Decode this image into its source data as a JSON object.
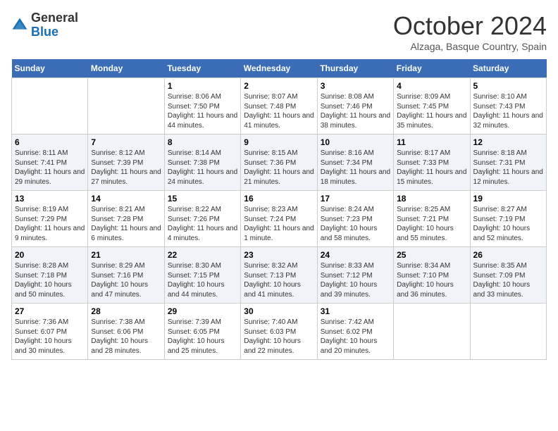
{
  "header": {
    "logo_general": "General",
    "logo_blue": "Blue",
    "month_title": "October 2024",
    "location": "Alzaga, Basque Country, Spain"
  },
  "days_of_week": [
    "Sunday",
    "Monday",
    "Tuesday",
    "Wednesday",
    "Thursday",
    "Friday",
    "Saturday"
  ],
  "weeks": [
    [
      {
        "day": "",
        "info": ""
      },
      {
        "day": "",
        "info": ""
      },
      {
        "day": "1",
        "info": "Sunrise: 8:06 AM\nSunset: 7:50 PM\nDaylight: 11 hours and 44 minutes."
      },
      {
        "day": "2",
        "info": "Sunrise: 8:07 AM\nSunset: 7:48 PM\nDaylight: 11 hours and 41 minutes."
      },
      {
        "day": "3",
        "info": "Sunrise: 8:08 AM\nSunset: 7:46 PM\nDaylight: 11 hours and 38 minutes."
      },
      {
        "day": "4",
        "info": "Sunrise: 8:09 AM\nSunset: 7:45 PM\nDaylight: 11 hours and 35 minutes."
      },
      {
        "day": "5",
        "info": "Sunrise: 8:10 AM\nSunset: 7:43 PM\nDaylight: 11 hours and 32 minutes."
      }
    ],
    [
      {
        "day": "6",
        "info": "Sunrise: 8:11 AM\nSunset: 7:41 PM\nDaylight: 11 hours and 29 minutes."
      },
      {
        "day": "7",
        "info": "Sunrise: 8:12 AM\nSunset: 7:39 PM\nDaylight: 11 hours and 27 minutes."
      },
      {
        "day": "8",
        "info": "Sunrise: 8:14 AM\nSunset: 7:38 PM\nDaylight: 11 hours and 24 minutes."
      },
      {
        "day": "9",
        "info": "Sunrise: 8:15 AM\nSunset: 7:36 PM\nDaylight: 11 hours and 21 minutes."
      },
      {
        "day": "10",
        "info": "Sunrise: 8:16 AM\nSunset: 7:34 PM\nDaylight: 11 hours and 18 minutes."
      },
      {
        "day": "11",
        "info": "Sunrise: 8:17 AM\nSunset: 7:33 PM\nDaylight: 11 hours and 15 minutes."
      },
      {
        "day": "12",
        "info": "Sunrise: 8:18 AM\nSunset: 7:31 PM\nDaylight: 11 hours and 12 minutes."
      }
    ],
    [
      {
        "day": "13",
        "info": "Sunrise: 8:19 AM\nSunset: 7:29 PM\nDaylight: 11 hours and 9 minutes."
      },
      {
        "day": "14",
        "info": "Sunrise: 8:21 AM\nSunset: 7:28 PM\nDaylight: 11 hours and 6 minutes."
      },
      {
        "day": "15",
        "info": "Sunrise: 8:22 AM\nSunset: 7:26 PM\nDaylight: 11 hours and 4 minutes."
      },
      {
        "day": "16",
        "info": "Sunrise: 8:23 AM\nSunset: 7:24 PM\nDaylight: 11 hours and 1 minute."
      },
      {
        "day": "17",
        "info": "Sunrise: 8:24 AM\nSunset: 7:23 PM\nDaylight: 10 hours and 58 minutes."
      },
      {
        "day": "18",
        "info": "Sunrise: 8:25 AM\nSunset: 7:21 PM\nDaylight: 10 hours and 55 minutes."
      },
      {
        "day": "19",
        "info": "Sunrise: 8:27 AM\nSunset: 7:19 PM\nDaylight: 10 hours and 52 minutes."
      }
    ],
    [
      {
        "day": "20",
        "info": "Sunrise: 8:28 AM\nSunset: 7:18 PM\nDaylight: 10 hours and 50 minutes."
      },
      {
        "day": "21",
        "info": "Sunrise: 8:29 AM\nSunset: 7:16 PM\nDaylight: 10 hours and 47 minutes."
      },
      {
        "day": "22",
        "info": "Sunrise: 8:30 AM\nSunset: 7:15 PM\nDaylight: 10 hours and 44 minutes."
      },
      {
        "day": "23",
        "info": "Sunrise: 8:32 AM\nSunset: 7:13 PM\nDaylight: 10 hours and 41 minutes."
      },
      {
        "day": "24",
        "info": "Sunrise: 8:33 AM\nSunset: 7:12 PM\nDaylight: 10 hours and 39 minutes."
      },
      {
        "day": "25",
        "info": "Sunrise: 8:34 AM\nSunset: 7:10 PM\nDaylight: 10 hours and 36 minutes."
      },
      {
        "day": "26",
        "info": "Sunrise: 8:35 AM\nSunset: 7:09 PM\nDaylight: 10 hours and 33 minutes."
      }
    ],
    [
      {
        "day": "27",
        "info": "Sunrise: 7:36 AM\nSunset: 6:07 PM\nDaylight: 10 hours and 30 minutes."
      },
      {
        "day": "28",
        "info": "Sunrise: 7:38 AM\nSunset: 6:06 PM\nDaylight: 10 hours and 28 minutes."
      },
      {
        "day": "29",
        "info": "Sunrise: 7:39 AM\nSunset: 6:05 PM\nDaylight: 10 hours and 25 minutes."
      },
      {
        "day": "30",
        "info": "Sunrise: 7:40 AM\nSunset: 6:03 PM\nDaylight: 10 hours and 22 minutes."
      },
      {
        "day": "31",
        "info": "Sunrise: 7:42 AM\nSunset: 6:02 PM\nDaylight: 10 hours and 20 minutes."
      },
      {
        "day": "",
        "info": ""
      },
      {
        "day": "",
        "info": ""
      }
    ]
  ]
}
